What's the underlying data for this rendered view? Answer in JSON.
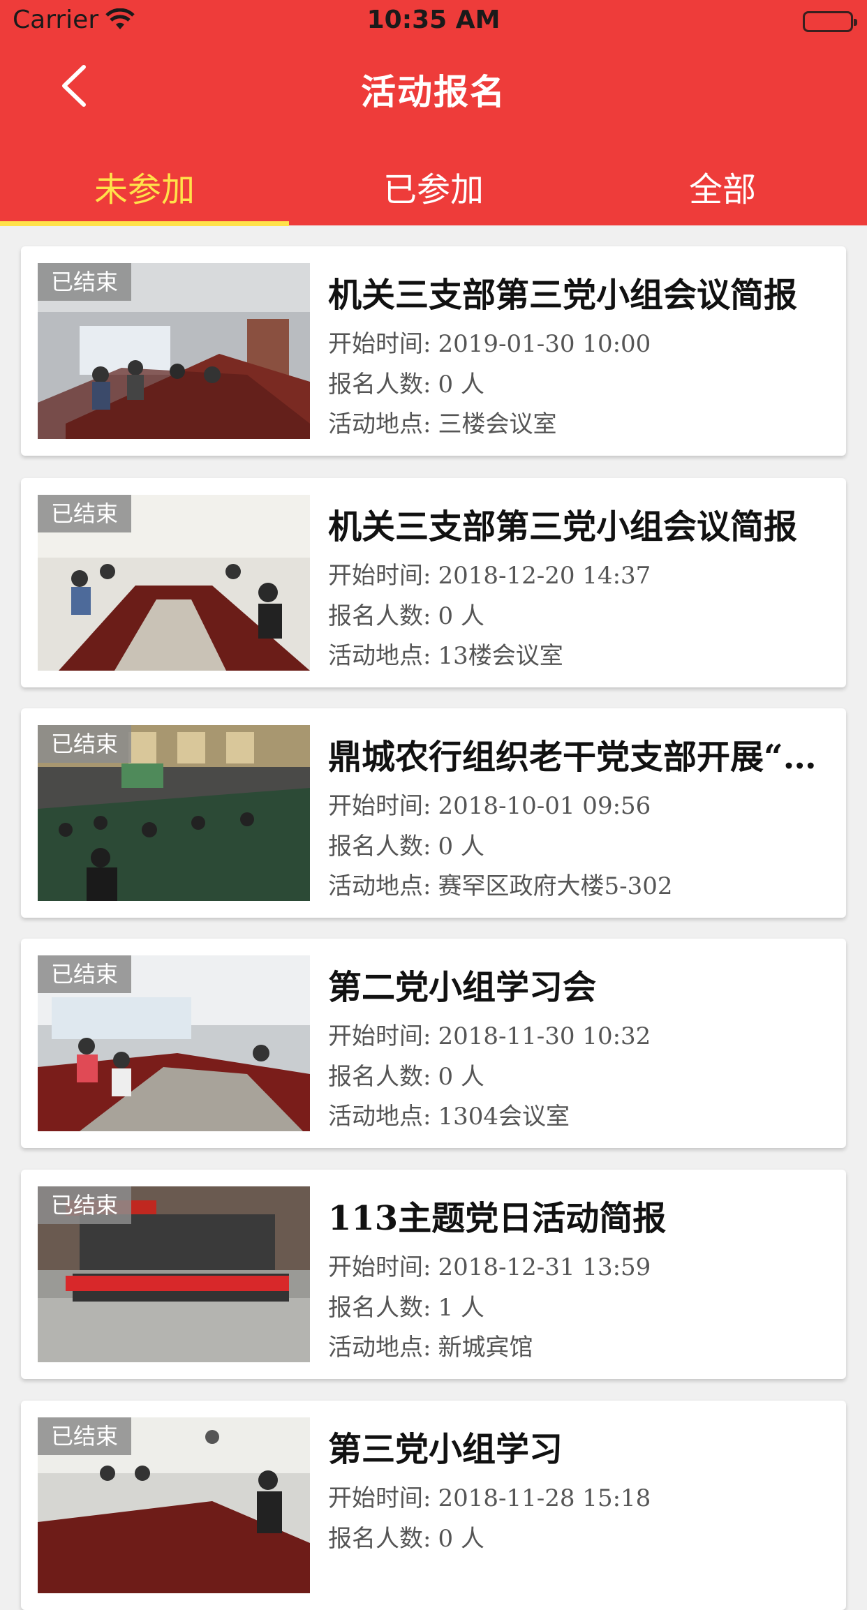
{
  "status_bar": {
    "carrier": "Carrier",
    "time": "10:35 AM"
  },
  "nav": {
    "title": "活动报名"
  },
  "tabs": [
    {
      "label": "未参加",
      "active": true
    },
    {
      "label": "已参加",
      "active": false
    },
    {
      "label": "全部",
      "active": false
    }
  ],
  "labels": {
    "start": "开始时间:",
    "count": "报名人数:",
    "location": "活动地点:"
  },
  "colors": {
    "accent": "#ee3c3a",
    "tab_active": "#ffe24a"
  },
  "events": [
    {
      "badge": "已结束",
      "title": "机关三支部第三党小组会议简报",
      "start": "2019-01-30 10:00",
      "count": "0 人",
      "location": "三楼会议室"
    },
    {
      "badge": "已结束",
      "title": "机关三支部第三党小组会议简报",
      "start": "2018-12-20 14:37",
      "count": "0 人",
      "location": "13楼会议室"
    },
    {
      "badge": "已结束",
      "title": "鼎城农行组织老干党支部开展“…",
      "start": "2018-10-01 09:56",
      "count": "0 人",
      "location": "赛罕区政府大楼5-302"
    },
    {
      "badge": "已结束",
      "title": "第二党小组学习会",
      "start": "2018-11-30 10:32",
      "count": "0 人",
      "location": "1304会议室"
    },
    {
      "badge": "已结束",
      "title": "113主题党日活动简报",
      "start": "2018-12-31 13:59",
      "count": "1 人",
      "location": "新城宾馆"
    },
    {
      "badge": "已结束",
      "title": "第三党小组学习",
      "start": "2018-11-28 15:18",
      "count": "0 人",
      "location": ""
    }
  ]
}
